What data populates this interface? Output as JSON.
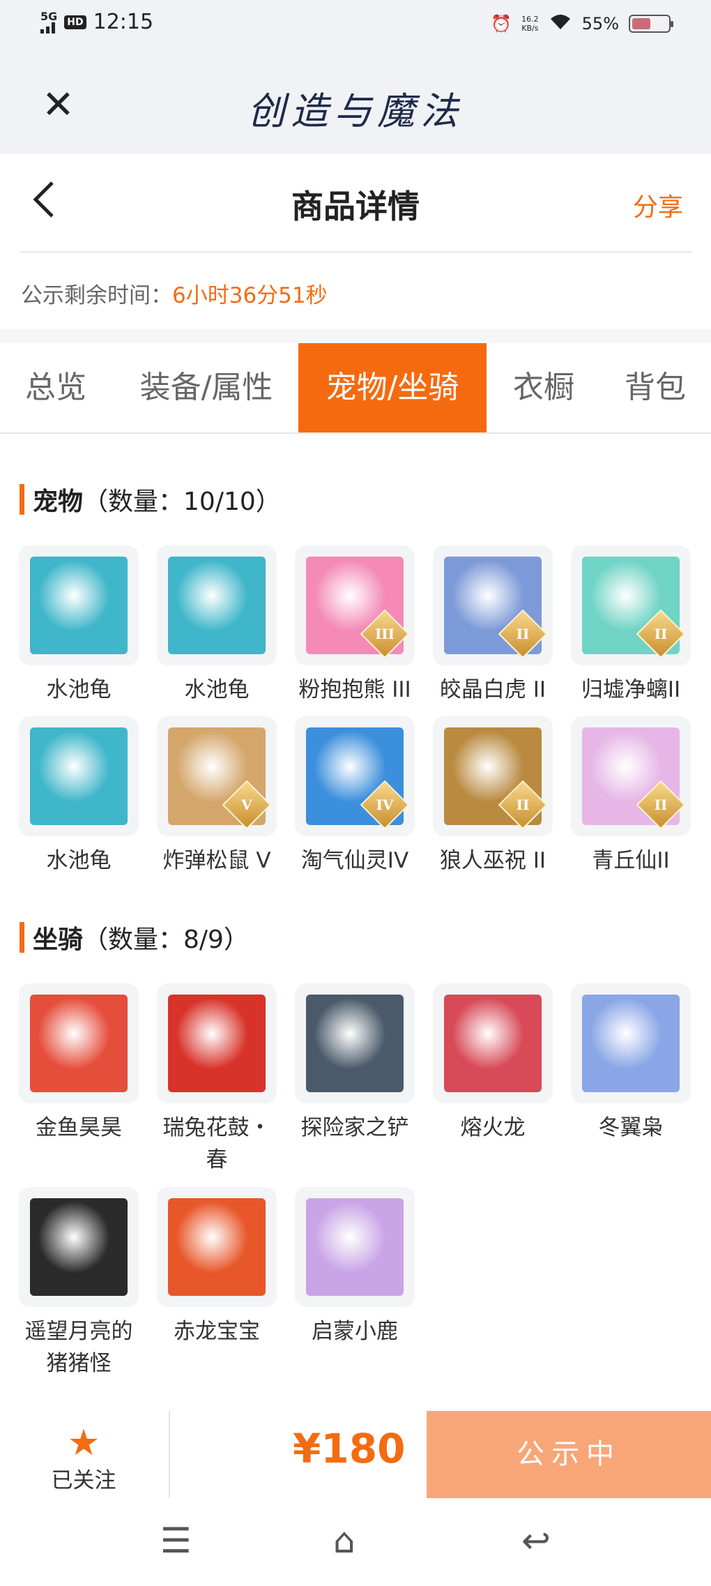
{
  "status_bar": {
    "network": "5G",
    "hd": "HD",
    "time": "12:15",
    "speed_value": "16.2",
    "speed_unit": "KB/s",
    "battery": "55%",
    "battery_level": 0.55
  },
  "app_bar": {
    "title": "创造与魔法"
  },
  "nav": {
    "title": "商品详情",
    "share": "分享"
  },
  "timer": {
    "label": "公示剩余时间：",
    "value": "6小时36分51秒"
  },
  "tabs": [
    {
      "label": "总览"
    },
    {
      "label": "装备/属性"
    },
    {
      "label": "宠物/坐骑"
    },
    {
      "label": "衣橱"
    },
    {
      "label": "背包"
    }
  ],
  "pets": {
    "title": "宠物",
    "count": "（数量：10/10）",
    "items": [
      {
        "name": "水池龟",
        "badge": "",
        "icon": "turtle-icon",
        "color": "#3fb6c9"
      },
      {
        "name": "水池龟",
        "badge": "",
        "icon": "turtle-icon",
        "color": "#3fb6c9"
      },
      {
        "name": "粉抱抱熊 III",
        "badge": "III",
        "icon": "pink-bear-icon",
        "color": "#f48ab5"
      },
      {
        "name": "皎晶白虎 II",
        "badge": "II",
        "icon": "white-tiger-icon",
        "color": "#7d9ad8"
      },
      {
        "name": "归墟净螭II",
        "badge": "II",
        "icon": "jade-dragon-icon",
        "color": "#6fd3c5"
      },
      {
        "name": "水池龟",
        "badge": "",
        "icon": "turtle-icon",
        "color": "#3fb6c9"
      },
      {
        "name": "炸弹松鼠 V",
        "badge": "V",
        "icon": "squirrel-icon",
        "color": "#d4a66b"
      },
      {
        "name": "淘气仙灵IV",
        "badge": "IV",
        "icon": "fairy-dog-icon",
        "color": "#3c8fdc"
      },
      {
        "name": "狼人巫祝 II",
        "badge": "II",
        "icon": "werewolf-icon",
        "color": "#b98a3f"
      },
      {
        "name": "青丘仙II",
        "badge": "II",
        "icon": "fox-fairy-icon",
        "color": "#e6b6e6"
      }
    ]
  },
  "mounts": {
    "title": "坐骑",
    "count": "（数量：8/9）",
    "items": [
      {
        "name": "金鱼昊昊",
        "icon": "goldfish-icon",
        "color": "#e64e3c"
      },
      {
        "name": "瑞兔花鼓・春",
        "icon": "drum-icon",
        "color": "#d8332a"
      },
      {
        "name": "探险家之铲",
        "icon": "shovel-icon",
        "color": "#4a5a6a"
      },
      {
        "name": "熔火龙",
        "icon": "lava-dragon-icon",
        "color": "#d84a58"
      },
      {
        "name": "冬翼枭",
        "icon": "owl-icon",
        "color": "#8aa6e6"
      },
      {
        "name": "遥望月亮的猪猪怪",
        "icon": "pig-icon",
        "color": "#2b2b2b"
      },
      {
        "name": "赤龙宝宝",
        "icon": "red-dragon-icon",
        "color": "#e8572a"
      },
      {
        "name": "启蒙小鹿",
        "icon": "deer-icon",
        "color": "#c9a4e6"
      }
    ]
  },
  "bottom": {
    "follow_label": "已关注",
    "price": "¥180",
    "status_button": "公示中"
  },
  "sys_nav": {
    "menu": "☰",
    "home": "⌂",
    "back": "↩"
  },
  "colors": {
    "accent": "#f36c12",
    "tab_active": "#f56a0f",
    "button": "#f8a678"
  }
}
